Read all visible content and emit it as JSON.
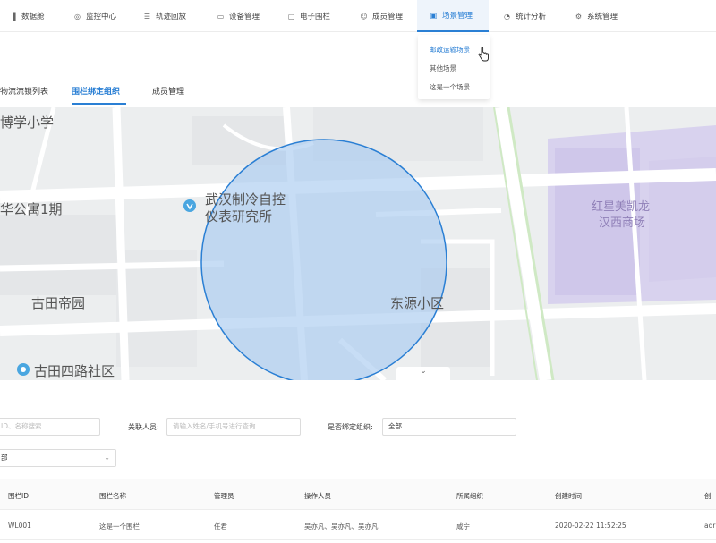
{
  "nav": {
    "items": [
      {
        "icon": "bar-chart-icon",
        "glyph": "▐",
        "label": "数据舱"
      },
      {
        "icon": "monitor-icon",
        "glyph": "◎",
        "label": "监控中心"
      },
      {
        "icon": "track-icon",
        "glyph": "☰",
        "label": "轨迹回放"
      },
      {
        "icon": "device-icon",
        "glyph": "▭",
        "label": "设备管理"
      },
      {
        "icon": "fence-icon",
        "glyph": "▢",
        "label": "电子围栏"
      },
      {
        "icon": "user-icon",
        "glyph": "☺",
        "label": "成员管理"
      },
      {
        "icon": "scene-icon",
        "glyph": "▣",
        "label": "场景管理"
      },
      {
        "icon": "pie-chart-icon",
        "glyph": "◔",
        "label": "统计分析"
      },
      {
        "icon": "gear-icon",
        "glyph": "⚙",
        "label": "系统管理"
      }
    ],
    "active_index": 6,
    "accent": "#2a7fd4"
  },
  "dropdown": {
    "items": [
      "邮政运输场景",
      "其他场景",
      "这是一个场景"
    ],
    "active_index": 0
  },
  "subtabs": [
    "物流流锁列表",
    "围栏绑定组织",
    "成员管理"
  ],
  "subtab_active": 1,
  "map": {
    "labels": {
      "school": "博学小学",
      "apartment": "华公寓1期",
      "institute_line1": "武汉制冷自控",
      "institute_line2": "仪表研究所",
      "gutian": "古田帝园",
      "dongyuan": "东源小区",
      "community": "古田四路社区",
      "mall_line1": "红星美凯龙",
      "mall_line2": "汉西商场"
    },
    "collapse_glyph": "⌄"
  },
  "filters": {
    "search_placeholder": "ID、名称搜索",
    "person_label": "关联人员:",
    "person_placeholder": "请输入姓名/手机号进行查询",
    "bind_label": "是否绑定组织:",
    "bind_value": "全部",
    "org_value": "部",
    "chevron": "⌄"
  },
  "table": {
    "headers": [
      "围栏ID",
      "围栏名称",
      "管理员",
      "操作人员",
      "所属组织",
      "创建时间",
      "创"
    ],
    "rows": [
      [
        "WL001",
        "这是一个围栏",
        "任君",
        "吴亦凡、吴亦凡、吴亦凡",
        "咸宁",
        "2020-02-22  11:52:25",
        "adr"
      ]
    ]
  }
}
